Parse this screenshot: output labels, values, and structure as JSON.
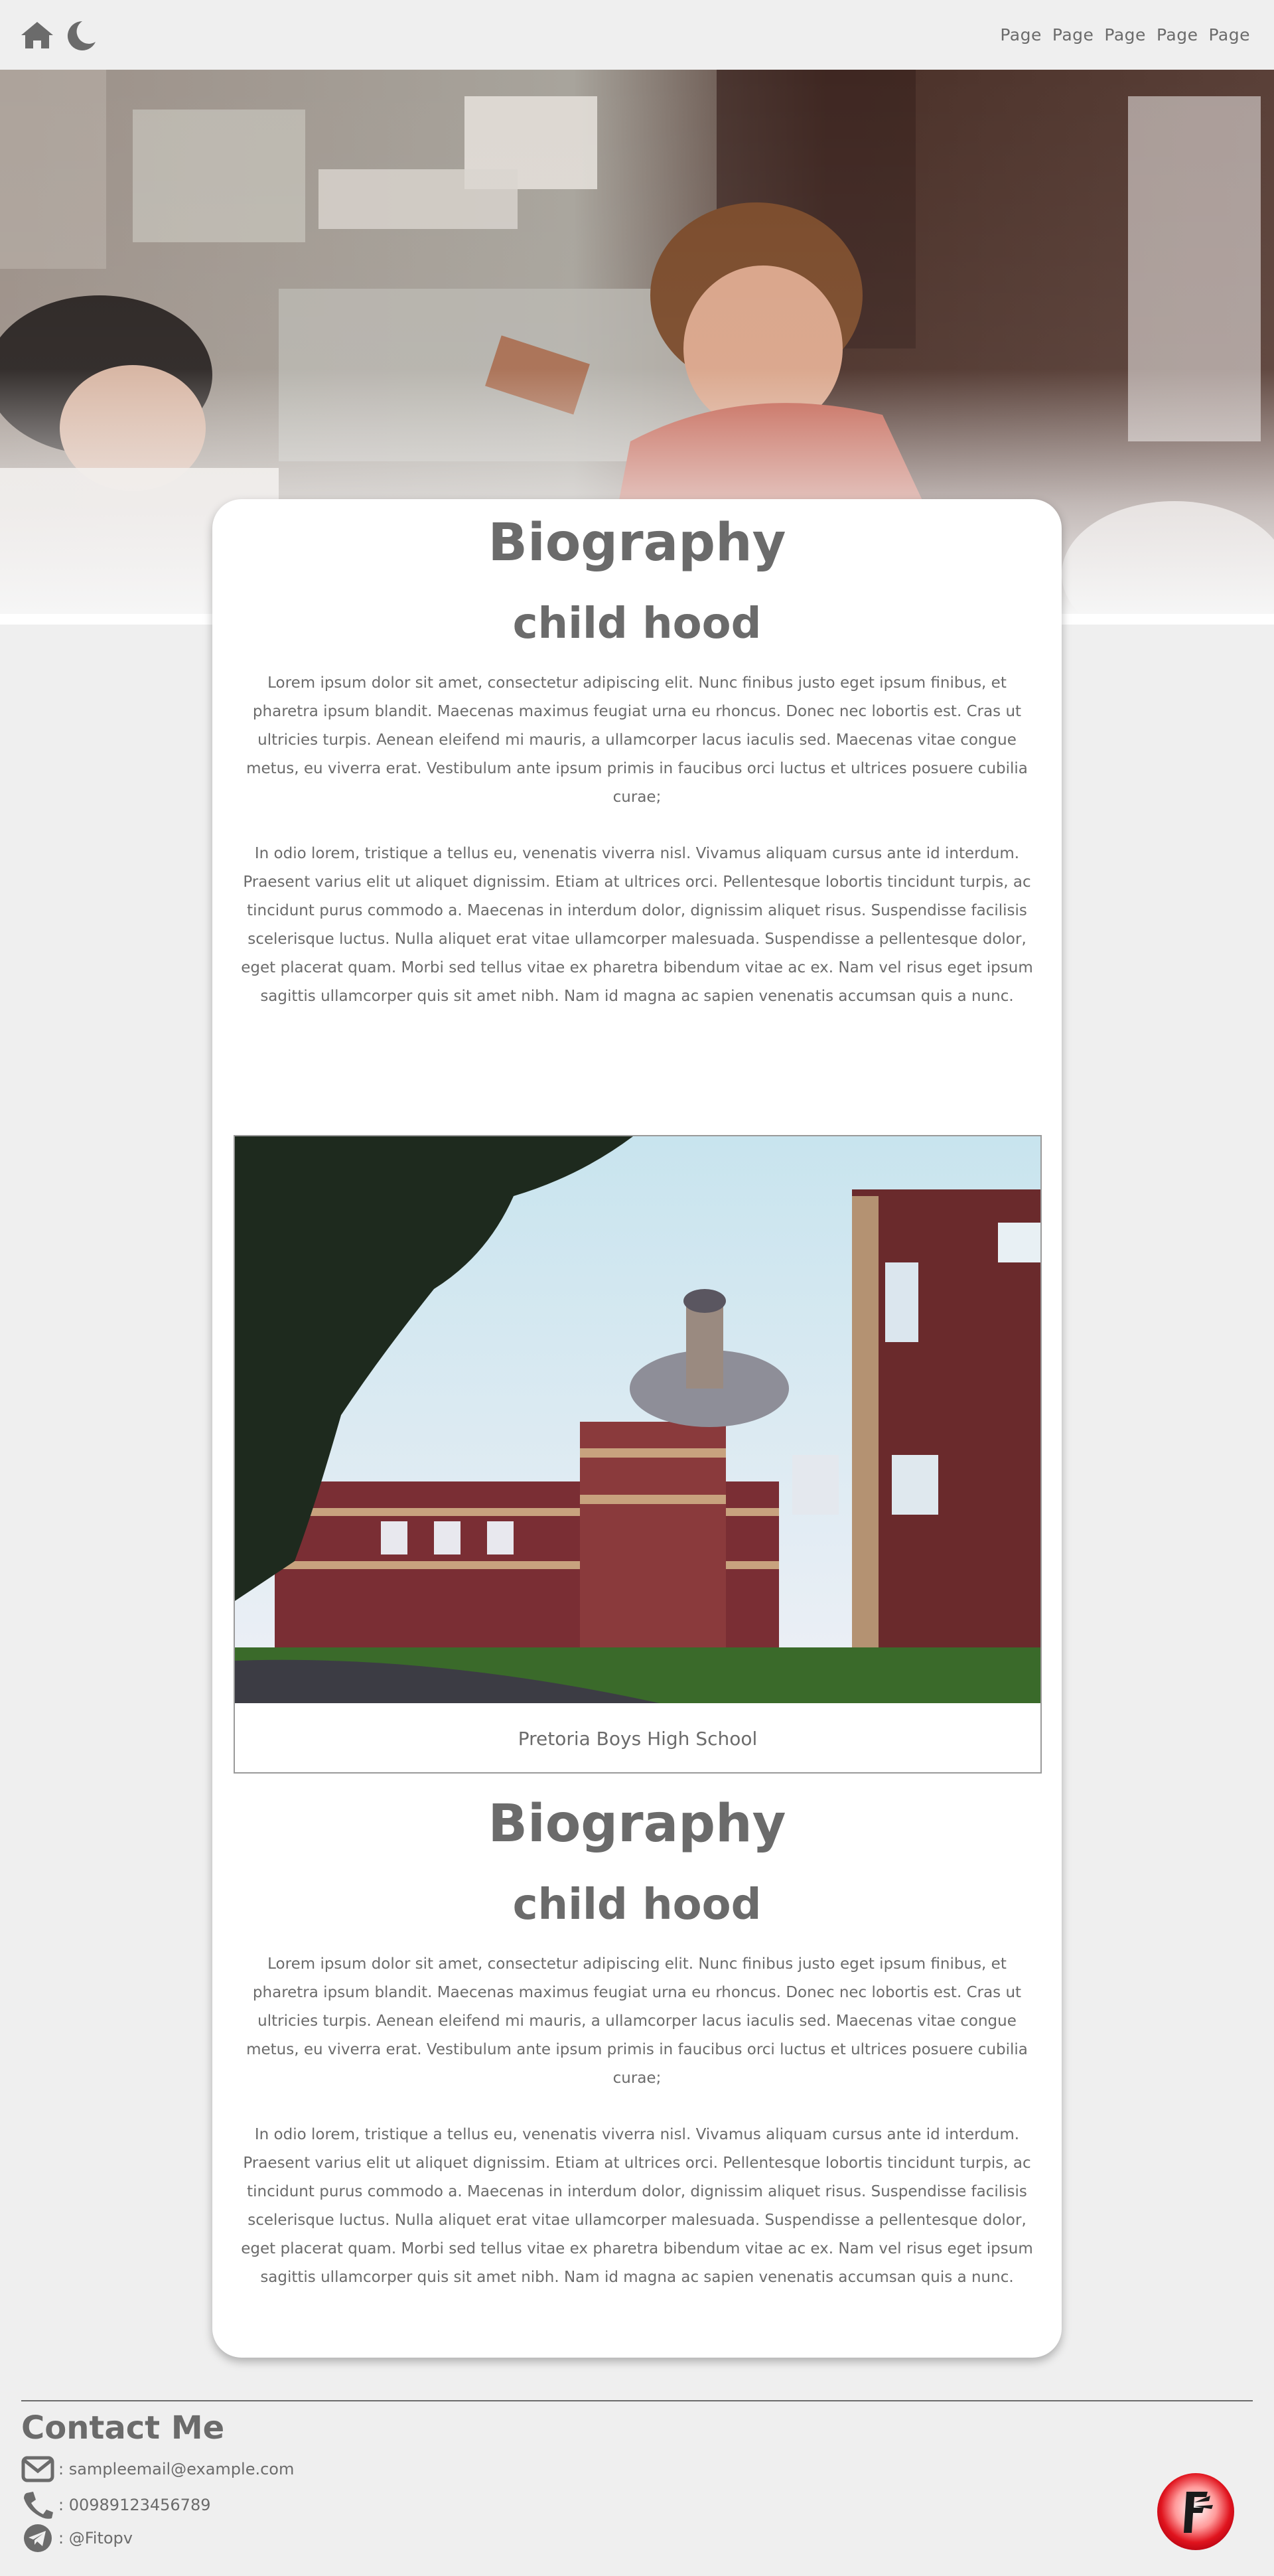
{
  "nav": {
    "links": [
      "Page",
      "Page",
      "Page",
      "Page",
      "Page"
    ]
  },
  "sections": [
    {
      "title": "Biography",
      "subtitle": "child hood",
      "paragraphs": [
        "Lorem ipsum dolor sit amet, consectetur adipiscing elit. Nunc finibus justo eget ipsum finibus, et pharetra ipsum blandit. Maecenas maximus feugiat urna eu rhoncus. Donec nec lobortis est. Cras ut ultricies turpis. Aenean eleifend mi mauris, a ullamcorper lacus iaculis sed. Maecenas vitae congue metus, eu viverra erat. Vestibulum ante ipsum primis in faucibus orci luctus et ultrices posuere cubilia curae;",
        "In odio lorem, tristique a tellus eu, venenatis viverra nisl. Vivamus aliquam cursus ante id interdum. Praesent varius elit ut aliquet dignissim. Etiam at ultrices orci. Pellentesque lobortis tincidunt turpis, ac tincidunt purus commodo a. Maecenas in interdum dolor, dignissim aliquet risus. Suspendisse facilisis scelerisque luctus. Nulla aliquet erat vitae ullamcorper malesuada. Suspendisse a pellentesque dolor, eget placerat quam. Morbi sed tellus vitae ex pharetra bibendum vitae ac ex. Nam vel risus eget ipsum sagittis ullamcorper quis sit amet nibh. Nam id magna ac sapien venenatis accumsan quis a nunc."
      ]
    },
    {
      "title": "Biography",
      "subtitle": "child hood",
      "paragraphs": [
        "Lorem ipsum dolor sit amet, consectetur adipiscing elit. Nunc finibus justo eget ipsum finibus, et pharetra ipsum blandit. Maecenas maximus feugiat urna eu rhoncus. Donec nec lobortis est. Cras ut ultricies turpis. Aenean eleifend mi mauris, a ullamcorper lacus iaculis sed. Maecenas vitae congue metus, eu viverra erat. Vestibulum ante ipsum primis in faucibus orci luctus et ultrices posuere cubilia curae;",
        "In odio lorem, tristique a tellus eu, venenatis viverra nisl. Vivamus aliquam cursus ante id interdum. Praesent varius elit ut aliquet dignissim. Etiam at ultrices orci. Pellentesque lobortis tincidunt turpis, ac tincidunt purus commodo a. Maecenas in interdum dolor, dignissim aliquet risus. Suspendisse facilisis scelerisque luctus. Nulla aliquet erat vitae ullamcorper malesuada. Suspendisse a pellentesque dolor, eget placerat quam. Morbi sed tellus vitae ex pharetra bibendum vitae ac ex. Nam vel risus eget ipsum sagittis ullamcorper quis sit amet nibh. Nam id magna ac sapien venenatis accumsan quis a nunc."
      ]
    }
  ],
  "figure": {
    "caption": "Pretoria Boys High School"
  },
  "contact": {
    "title": "Contact Me",
    "email": ": sampleemail@example.com",
    "phone": ": 00989123456789",
    "telegram": ": @Fitopv"
  },
  "icons": {
    "home": "home-icon",
    "theme": "moon-icon",
    "email": "envelope-icon",
    "phone": "phone-icon",
    "telegram": "telegram-icon"
  },
  "colors": {
    "text": "#6b6b6b",
    "background": "#efefef",
    "card": "#ffffff",
    "logo_red": "#e0141e"
  }
}
